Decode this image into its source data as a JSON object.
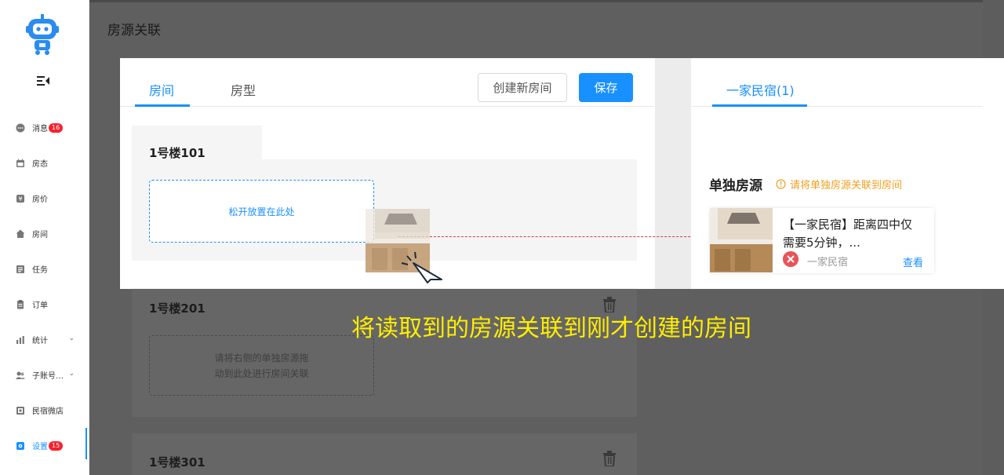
{
  "sidebar": {
    "items": [
      {
        "label": "消息",
        "badge": "16",
        "icon": "message-icon"
      },
      {
        "label": "房态",
        "icon": "calendar-icon"
      },
      {
        "label": "房价",
        "icon": "price-tag-icon"
      },
      {
        "label": "房间",
        "icon": "house-icon"
      },
      {
        "label": "任务",
        "icon": "task-icon"
      },
      {
        "label": "订单",
        "icon": "order-icon"
      },
      {
        "label": "统计",
        "icon": "bar-chart-icon",
        "expandable": true
      },
      {
        "label": "子账号…",
        "icon": "users-icon",
        "expandable": true
      },
      {
        "label": "民宿微店",
        "icon": "shop-icon"
      },
      {
        "label": "设置",
        "badge": "15",
        "icon": "settings-icon",
        "active": true
      }
    ]
  },
  "page": {
    "title": "房源关联"
  },
  "left_panel": {
    "tabs": [
      "房间",
      "房型"
    ],
    "active_tab": "房间",
    "create_button": "创建新房间",
    "save_button": "保存",
    "rooms": [
      {
        "name": "1号楼101",
        "drop_text": "松开放置在此处"
      },
      {
        "name": "1号楼201",
        "drop_text_line1": "请将右侧的单独房源拖",
        "drop_text_line2": "动到此处进行房间关联"
      },
      {
        "name": "1号楼301"
      }
    ]
  },
  "right_panel": {
    "tab": "一家民宿(1)",
    "section_title": "单独房源",
    "hint": "请将单独房源关联到房间",
    "listing": {
      "title_line1": "【一家民宿】距离四中仅",
      "title_line2": "需要5分钟，...",
      "shop": "一家民宿",
      "view": "查看"
    }
  },
  "caption": "将读取到的房源关联到刚才创建的房间",
  "colors": {
    "accent": "#1890ff",
    "badge": "#f5222d",
    "hint": "#f0a020",
    "caption": "#ffee00",
    "overlay": "#5f5f5f"
  }
}
